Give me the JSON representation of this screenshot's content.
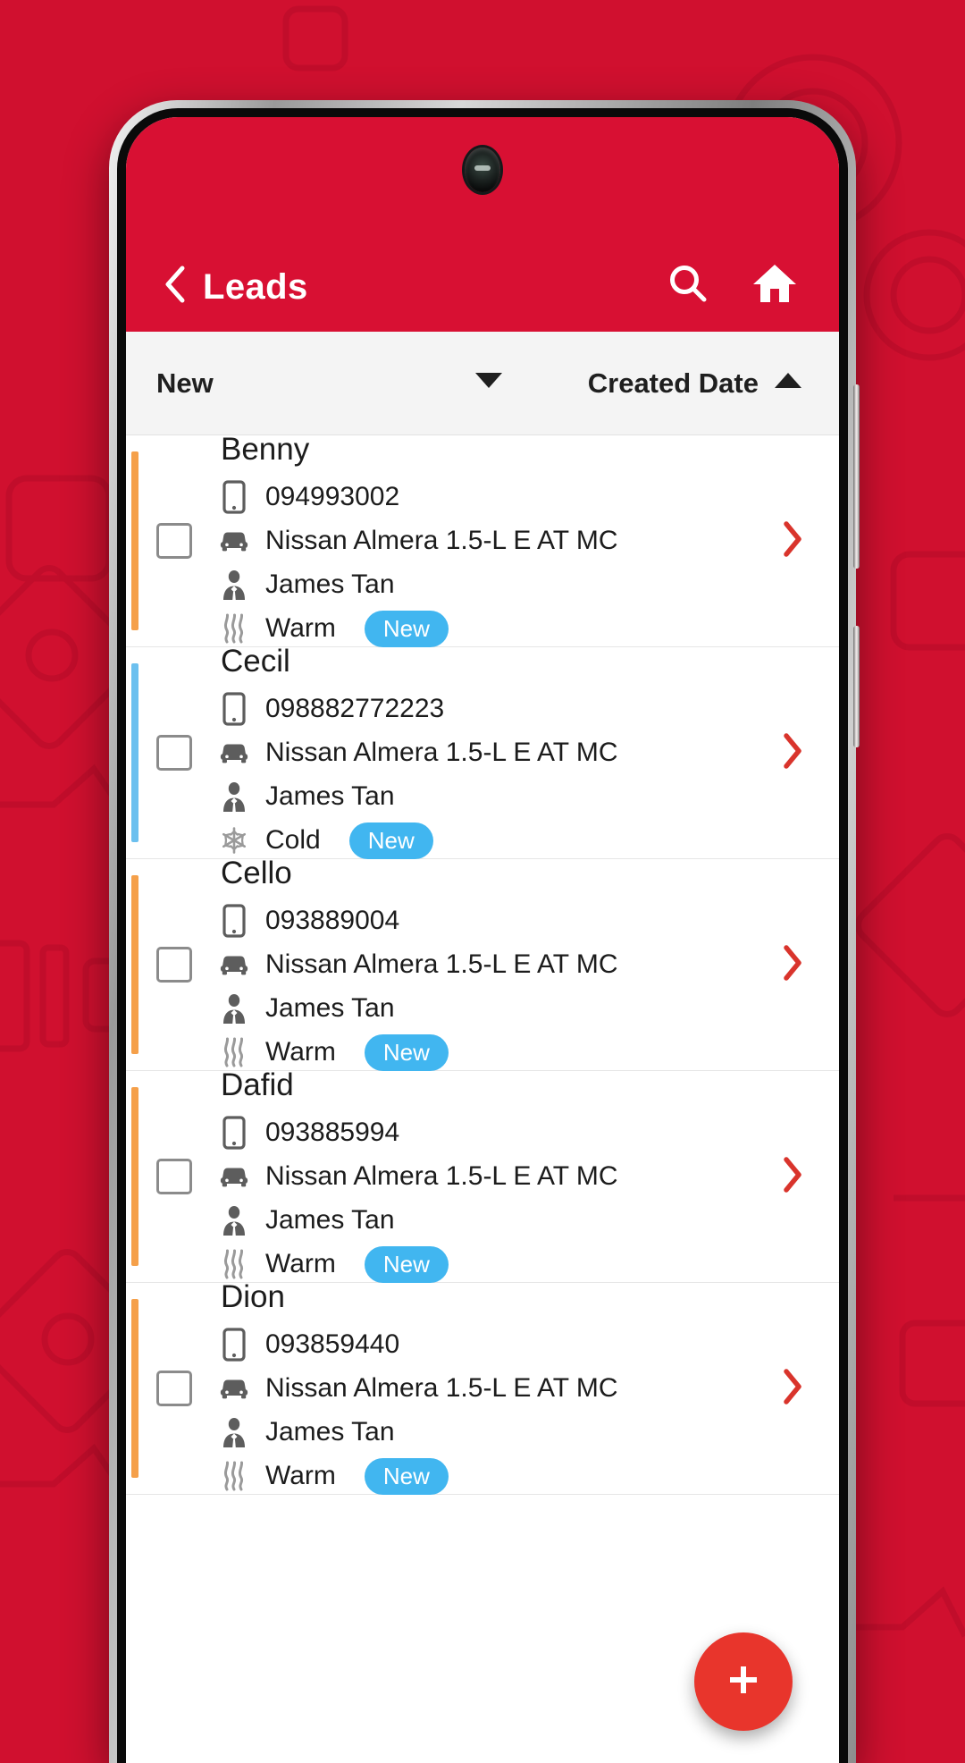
{
  "appbar": {
    "title": "Leads",
    "back_icon": "chevron-left-icon",
    "search_icon": "search-icon",
    "home_icon": "home-icon",
    "bg_color": "#d81033"
  },
  "filterbar": {
    "status_filter_value": "New",
    "status_filter_caret": "chevron-down-icon",
    "sort_label": "Created Date",
    "sort_direction_icon": "caret-up-icon",
    "sort_direction": "ascending"
  },
  "colors": {
    "brand_red": "#d0102f",
    "appbar_red": "#d81033",
    "chevron_red": "#d9342c",
    "fab_red": "#e8352c",
    "badge_blue": "#41b6f0",
    "accent_warm": "#f5a04a",
    "accent_cold": "#6cc0ef"
  },
  "list": {
    "leads": [
      {
        "name": "Benny",
        "phone": "094993002",
        "vehicle": "Nissan Almera 1.5-L E AT MC",
        "agent": "James Tan",
        "temperature": "Warm",
        "temperature_icon": "heat-waves-icon",
        "badge": "New",
        "accent_color": "#f5a04a",
        "checked": false
      },
      {
        "name": "Cecil",
        "phone": "098882772223",
        "vehicle": "Nissan Almera 1.5-L E AT MC",
        "agent": "James Tan",
        "temperature": "Cold",
        "temperature_icon": "snowflake-icon",
        "badge": "New",
        "accent_color": "#6cc0ef",
        "checked": false
      },
      {
        "name": "Cello",
        "phone": "093889004",
        "vehicle": "Nissan Almera 1.5-L E AT MC",
        "agent": "James Tan",
        "temperature": "Warm",
        "temperature_icon": "heat-waves-icon",
        "badge": "New",
        "accent_color": "#f5a04a",
        "checked": false
      },
      {
        "name": "Dafid",
        "phone": "093885994",
        "vehicle": "Nissan Almera 1.5-L E AT MC",
        "agent": "James Tan",
        "temperature": "Warm",
        "temperature_icon": "heat-waves-icon",
        "badge": "New",
        "accent_color": "#f5a04a",
        "checked": false
      },
      {
        "name": "Dion",
        "phone": "093859440",
        "vehicle": "Nissan Almera 1.5-L E AT MC",
        "agent": "James Tan",
        "temperature": "Warm",
        "temperature_icon": "heat-waves-icon",
        "badge": "New",
        "accent_color": "#f5a04a",
        "checked": false
      }
    ],
    "row_icons": {
      "phone": "mobile-phone-icon",
      "vehicle": "car-icon",
      "agent": "salesperson-icon",
      "detail_arrow": "chevron-right-icon"
    }
  },
  "fab": {
    "icon": "plus-icon",
    "label": "+"
  }
}
